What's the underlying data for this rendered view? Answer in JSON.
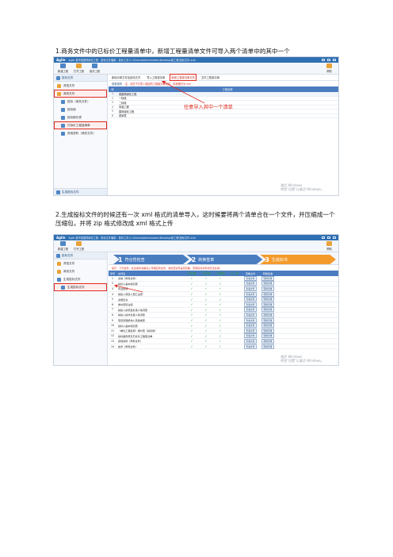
{
  "captions": {
    "one": "1.商务文件中的已标价工程量清单中，新增工程量清单文件可导入两个清单中的其中一个",
    "two": "2.生成投标文件的时候还有一次 xml 格式的清单导入，这时候要将两个清单合在一个文件，并压缩成一个压缩包，并将 zip 格式修改成 xml 格式上传"
  },
  "shot1": {
    "window_title": "Agile    某市某园林绿化工程 - 投标文件编制 - 投标工具 (C:\\Users\\Administrator\\Desktop\\某工程\\投标文件.zcb)",
    "logo": "Agile",
    "toolbar": [
      {
        "label": "新建工程",
        "color": "#4f86c6"
      },
      {
        "label": "打开工程",
        "color": "#e9a33a"
      },
      {
        "label": "保存工程",
        "color": "#4f86c6"
      }
    ],
    "help_label": "帮助",
    "sidebar": {
      "header": "投标文件",
      "items": [
        {
          "label": "资信文件",
          "level": "top",
          "icon": "folder-icon",
          "highlight": false
        },
        {
          "label": "商务文件",
          "level": "top",
          "icon": "folder-icon",
          "highlight": true
        },
        {
          "label": "投标（商务文件）",
          "level": "sub",
          "icon": "doc-icon",
          "highlight": false
        },
        {
          "label": "投标函",
          "level": "sub",
          "icon": "doc-icon",
          "highlight": false
        },
        {
          "label": "投标报价表",
          "level": "sub",
          "icon": "doc-icon",
          "highlight": false
        },
        {
          "label": "已标价工程量清单",
          "level": "sub",
          "icon": "doc-icon",
          "highlight": true
        },
        {
          "label": "其他资料（商务文件）",
          "level": "sub",
          "icon": "doc-icon",
          "highlight": false
        }
      ],
      "footer": "生成投标文件"
    },
    "tabs": [
      "新增清单文件及投标文件",
      "导入工程量清单",
      "新增工程量清单文件",
      "文件工程量清单"
    ],
    "active_tab_index": 2,
    "notice_prefix": "查看说明",
    "notice_red": "注：请在下方导入相应的工程量清单文件，标准格式为 xml",
    "grid_header": {
      "index": "序",
      "name": "工程名称"
    },
    "grid_rows": [
      {
        "index": "1",
        "name": "某园林绿化工程"
      },
      {
        "index": "2",
        "name": "一标段"
      },
      {
        "index": "3",
        "name": "二标段"
      },
      {
        "index": "4",
        "name": "安装工程"
      },
      {
        "index": "5",
        "name": "园林绿化工程"
      },
      {
        "index": "6",
        "name": "费用表"
      }
    ],
    "annotation": "任意导入其中一个清单",
    "watermark_line1": "激活 Windows",
    "watermark_line2": "转到\"设置\"以激活 Windows。"
  },
  "shot2": {
    "window_title": "Agile    某市某园林绿化工程 - 投标文件编制 - 投标工具 (C:\\Users\\Administrator\\Desktop\\某工程\\投标文件.zcb)",
    "logo": "Agile",
    "toolbar": [
      {
        "label": "新建工程",
        "color": "#4f86c6"
      },
      {
        "label": "打开工程",
        "color": "#e9a33a"
      }
    ],
    "help_label": "帮助",
    "sidebar": {
      "header": "投标文件",
      "items": [
        {
          "label": "资信文件",
          "level": "top",
          "icon": "folder-icon",
          "highlight": false
        },
        {
          "label": "商务文件",
          "level": "top",
          "icon": "folder-icon",
          "highlight": false
        },
        {
          "label": "生成投标文件",
          "level": "top",
          "icon": "doc-icon",
          "highlight": false
        },
        {
          "label": "生成投标文件",
          "level": "sub",
          "icon": "doc-icon",
          "highlight": true
        }
      ]
    },
    "steps": [
      {
        "num": "1",
        "label": "符合性检查"
      },
      {
        "num": "2",
        "label": "转换签章"
      },
      {
        "num": "3",
        "label": "生成标书"
      }
    ],
    "step_hint": "提示：下列文件，在生成标书前请上传相应的文件，并检查文件是否完整，否则投标文件将无法生成！",
    "table_header": [
      "序号",
      "文件名",
      "已检查",
      "已签章",
      "已转换",
      "已上传",
      "查看文件",
      "转换签章"
    ],
    "rows": [
      {
        "index": "1",
        "name": "资信（商务文件）",
        "checked": "✓",
        "signed": "✓",
        "converted": "✓",
        "view": "查看文件",
        "sign": "转换签章"
      },
      {
        "index": "2",
        "name": "投标人基本情况表",
        "checked": "✓",
        "signed": "✓",
        "converted": "✓",
        "view": "查看文件",
        "sign": "转换签章"
      },
      {
        "index": "3",
        "name": "营业执照",
        "checked": "✓",
        "signed": "✓",
        "converted": "✓",
        "view": "查看文件",
        "sign": "转换签章"
      },
      {
        "index": "4",
        "name": "拟投入项目人员汇总表",
        "checked": "✓",
        "signed": "✓",
        "converted": "✓",
        "view": "查看文件",
        "sign": "转换签章"
      },
      {
        "index": "5",
        "name": "资质证书",
        "checked": "✓",
        "signed": "✓",
        "converted": "✓",
        "view": "查看文件",
        "sign": "转换签章"
      },
      {
        "index": "6",
        "name": "类似项目业绩",
        "checked": "✓",
        "signed": "✓",
        "converted": "✓",
        "view": "查看文件",
        "sign": "转换签章"
      },
      {
        "index": "7",
        "name": "拟投入的项目负责人情况表",
        "checked": "✓",
        "signed": "✓",
        "converted": "✓",
        "view": "查看文件",
        "sign": "转换签章"
      },
      {
        "index": "8",
        "name": "拟投入技术负责人情况表",
        "checked": "✓",
        "signed": "✓",
        "converted": "✓",
        "view": "查看文件",
        "sign": "转换签章"
      },
      {
        "index": "9",
        "name": "项目管理机构人员组成表",
        "checked": "✓",
        "signed": "✓",
        "converted": "✓",
        "view": "查看文件",
        "sign": "转换签章"
      },
      {
        "index": "10",
        "name": "投标人基本情况表",
        "checked": "✓",
        "signed": "✓",
        "converted": "✓",
        "view": "查看文件",
        "sign": "转换签章"
      },
      {
        "index": "11",
        "name": "（单位工程名称）报价表（投标用）",
        "checked": "✓",
        "signed": "✓",
        "converted": "✓",
        "view": "查看文件",
        "sign": "转换签章"
      },
      {
        "index": "12",
        "name": "投标函附录及已标价工程量清单",
        "checked": "✓",
        "signed": "✓",
        "converted": "✓",
        "view": "查看文件",
        "sign": "转换签章"
      },
      {
        "index": "13",
        "name": "其他资料（商务文件）",
        "checked": "✓",
        "signed": "✓",
        "converted": "✓",
        "view": "查看文件",
        "sign": "转换签章"
      },
      {
        "index": "14",
        "name": "技术（商务文件）",
        "checked": "✓",
        "signed": "✓",
        "converted": "✓",
        "view": "查看文件",
        "sign": "转换签章"
      }
    ],
    "watermark_line1": "激活 Windows",
    "watermark_line2": "转到\"设置\"以激活 Windows。"
  }
}
